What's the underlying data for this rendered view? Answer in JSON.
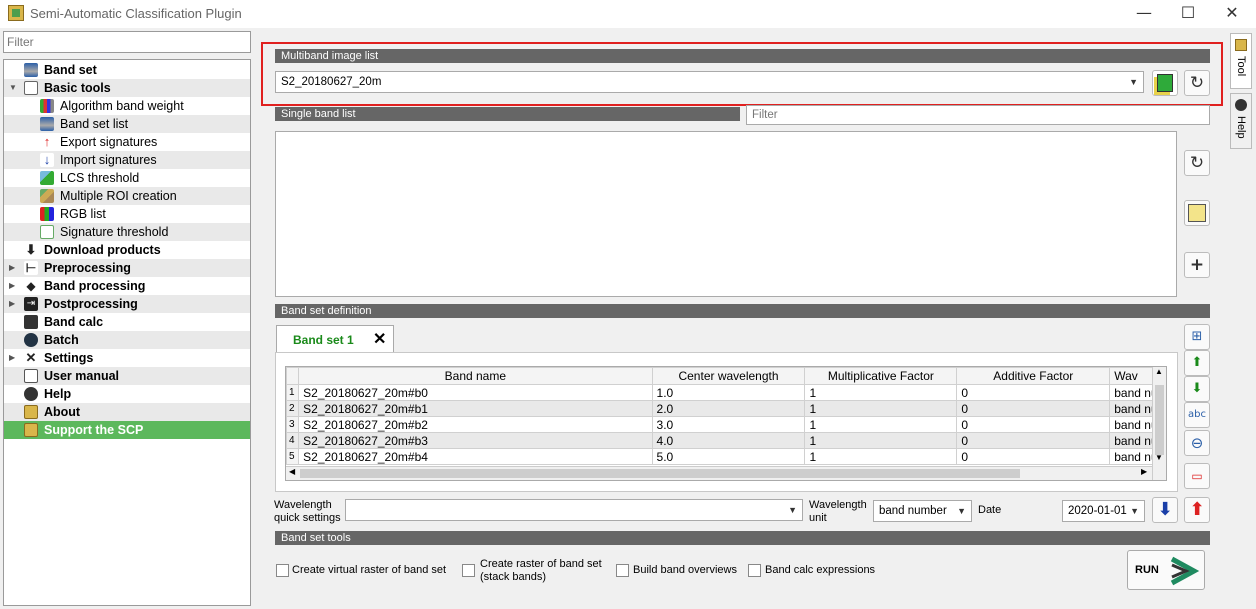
{
  "window": {
    "title": "Semi-Automatic Classification Plugin",
    "controls": [
      "—",
      "☐",
      "✕"
    ]
  },
  "left": {
    "filter_placeholder": "Filter",
    "tree": [
      {
        "label": "Band set",
        "level": 0,
        "icon": "band-set-icon"
      },
      {
        "label": "Basic tools",
        "level": 0,
        "expanded": true,
        "icon": "basic-tools-icon"
      },
      {
        "label": "Algorithm band weight",
        "level": 1,
        "icon": "algorithm-band-weight-icon"
      },
      {
        "label": "Band set list",
        "level": 1,
        "icon": "band-set-list-icon"
      },
      {
        "label": "Export signatures",
        "level": 1,
        "icon": "export-signatures-icon"
      },
      {
        "label": "Import signatures",
        "level": 1,
        "icon": "import-signatures-icon"
      },
      {
        "label": "LCS threshold",
        "level": 1,
        "icon": "lcs-threshold-icon"
      },
      {
        "label": "Multiple ROI creation",
        "level": 1,
        "icon": "multiple-roi-icon"
      },
      {
        "label": "RGB list",
        "level": 1,
        "icon": "rgb-list-icon"
      },
      {
        "label": "Signature threshold",
        "level": 1,
        "icon": "signature-threshold-icon"
      },
      {
        "label": "Download products",
        "level": 0,
        "icon": "download-icon"
      },
      {
        "label": "Preprocessing",
        "level": 0,
        "collapsed": true,
        "icon": "preprocessing-icon"
      },
      {
        "label": "Band processing",
        "level": 0,
        "collapsed": true,
        "icon": "band-processing-icon"
      },
      {
        "label": "Postprocessing",
        "level": 0,
        "collapsed": true,
        "icon": "postprocessing-icon"
      },
      {
        "label": "Band calc",
        "level": 0,
        "icon": "band-calc-icon"
      },
      {
        "label": "Batch",
        "level": 0,
        "icon": "batch-icon"
      },
      {
        "label": "Settings",
        "level": 0,
        "collapsed": true,
        "icon": "settings-icon"
      },
      {
        "label": "User manual",
        "level": 0,
        "icon": "user-manual-icon"
      },
      {
        "label": "Help",
        "level": 0,
        "icon": "help-icon"
      },
      {
        "label": "About",
        "level": 0,
        "icon": "about-icon"
      },
      {
        "label": "Support the SCP",
        "level": 0,
        "selected": true,
        "icon": "support-icon"
      }
    ]
  },
  "multiband": {
    "header": "Multiband image list",
    "selected": "S2_20180627_20m"
  },
  "single_band": {
    "header": "Single band list",
    "filter_placeholder": "Filter"
  },
  "band_set_definition": {
    "header": "Band set definition",
    "tab_label": "Band set 1",
    "columns": [
      "Band name",
      "Center wavelength",
      "Multiplicative Factor",
      "Additive Factor",
      "Wav"
    ],
    "rows": [
      {
        "idx": "1",
        "name": "S2_20180627_20m#b0",
        "wavelength": "1.0",
        "mult": "1",
        "add": "0",
        "wav": "band num"
      },
      {
        "idx": "2",
        "name": "S2_20180627_20m#b1",
        "wavelength": "2.0",
        "mult": "1",
        "add": "0",
        "wav": "band num"
      },
      {
        "idx": "3",
        "name": "S2_20180627_20m#b2",
        "wavelength": "3.0",
        "mult": "1",
        "add": "0",
        "wav": "band num"
      },
      {
        "idx": "4",
        "name": "S2_20180627_20m#b3",
        "wavelength": "4.0",
        "mult": "1",
        "add": "0",
        "wav": "band num"
      },
      {
        "idx": "5",
        "name": "S2_20180627_20m#b4",
        "wavelength": "5.0",
        "mult": "1",
        "add": "0",
        "wav": "band num"
      }
    ]
  },
  "wavelength": {
    "quick_label_1": "Wavelength",
    "quick_label_2": "quick settings",
    "quick_value": "",
    "unit_label_1": "Wavelength",
    "unit_label_2": "unit",
    "unit_value": "band number",
    "date_label": "Date",
    "date_value": "2020-01-01"
  },
  "band_set_tools": {
    "header": "Band set tools",
    "options": [
      {
        "label": "Create virtual raster of band set",
        "checked": false
      },
      {
        "label_1": "Create raster of band set",
        "label_2": "(stack bands)",
        "checked": false
      },
      {
        "label": "Build band overviews",
        "checked": false
      },
      {
        "label": "Band calc expressions",
        "checked": false
      }
    ],
    "run_label": "RUN"
  },
  "side_tabs": [
    "Tool",
    "Help"
  ],
  "colors": {
    "accent_green": "#5cb85c",
    "highlight_red": "#e0201f",
    "section_gray": "#666666"
  }
}
